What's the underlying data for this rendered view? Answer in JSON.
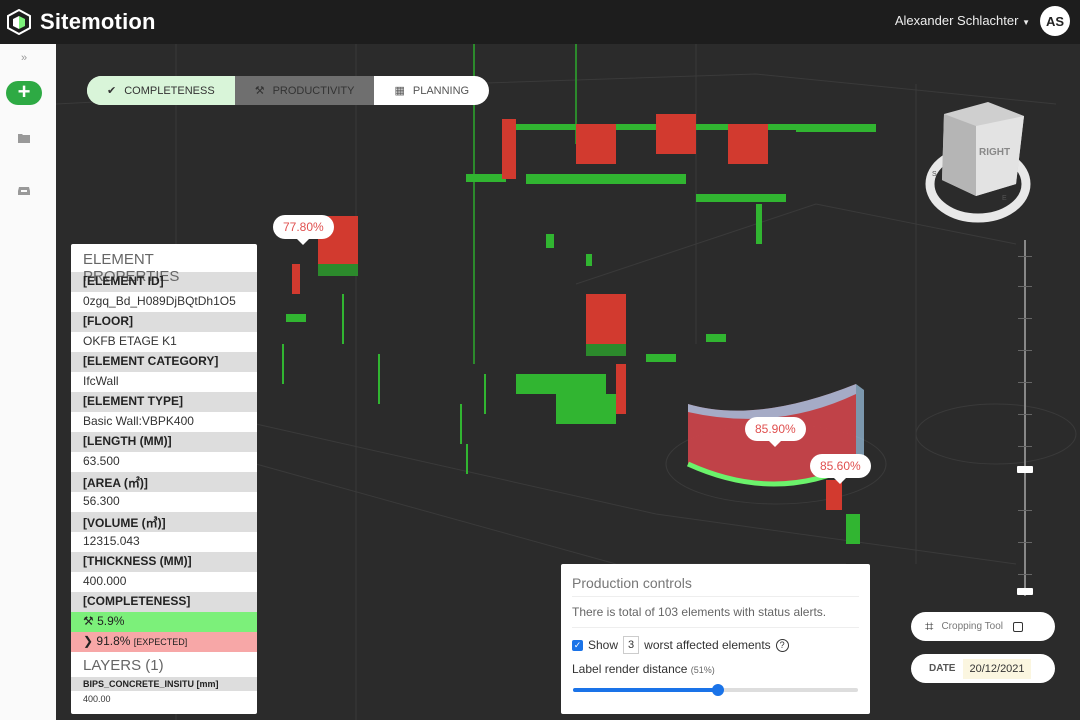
{
  "app": {
    "title": "Sitemotion"
  },
  "header": {
    "user_name": "Alexander Schlachter",
    "avatar_initials": "AS"
  },
  "sidebar": {
    "add_label": "+"
  },
  "tabs": [
    {
      "label": "COMPLETENESS",
      "icon": "check-icon",
      "active": true
    },
    {
      "label": "PRODUCTIVITY",
      "icon": "hammer-icon",
      "active": false
    },
    {
      "label": "PLANNING",
      "icon": "calendar-icon",
      "active": false
    }
  ],
  "labels": {
    "a": "77.80%",
    "b": "85.90%",
    "c": "85.60%"
  },
  "view_cube": {
    "face": "RIGHT",
    "compass_s": "S",
    "compass_e": "E"
  },
  "element_properties": {
    "title": "ELEMENT PROPERTIES",
    "rows": [
      {
        "key": "[ELEMENT ID]",
        "value": "0zgq_Bd_H089DjBQtDh1O5"
      },
      {
        "key": "[FLOOR]",
        "value": "OKFB ETAGE K1"
      },
      {
        "key": "[ELEMENT CATEGORY]",
        "value": "IfcWall"
      },
      {
        "key": "[ELEMENT TYPE]",
        "value": "Basic Wall:VBPK400"
      },
      {
        "key": "[LENGTH (MM)]",
        "value": "63.500"
      },
      {
        "key": "[AREA (㎡)]",
        "value": "56.300"
      },
      {
        "key": "[VOLUME (㎥)]",
        "value": "12315.043"
      },
      {
        "key": "[THICKNESS (MM)]",
        "value": "400.000"
      }
    ],
    "completeness_key": "[COMPLETENESS]",
    "completeness_actual": "5.9%",
    "completeness_expected": "91.8%",
    "expected_tag": "[EXPECTED]",
    "layers_title": "LAYERS (1)",
    "layer_key": "BIPS_CONCRETE_INSITU [mm]",
    "layer_value": "400.00"
  },
  "production_controls": {
    "title": "Production controls",
    "message": "There is total of 103 elements with status alerts.",
    "show_label": "Show",
    "show_count": "3",
    "worst_label": "worst affected elements",
    "distance_label": "Label render distance",
    "distance_pct": "(51%)",
    "distance_value": 0.51
  },
  "cropping_tool": {
    "label": "Cropping Tool"
  },
  "date": {
    "label": "DATE",
    "value": "20/12/2021"
  },
  "colors": {
    "accent_green": "#2eaa44",
    "complete": "#7cf07a",
    "expected": "#f7a7a7",
    "alert": "#e0504f"
  }
}
